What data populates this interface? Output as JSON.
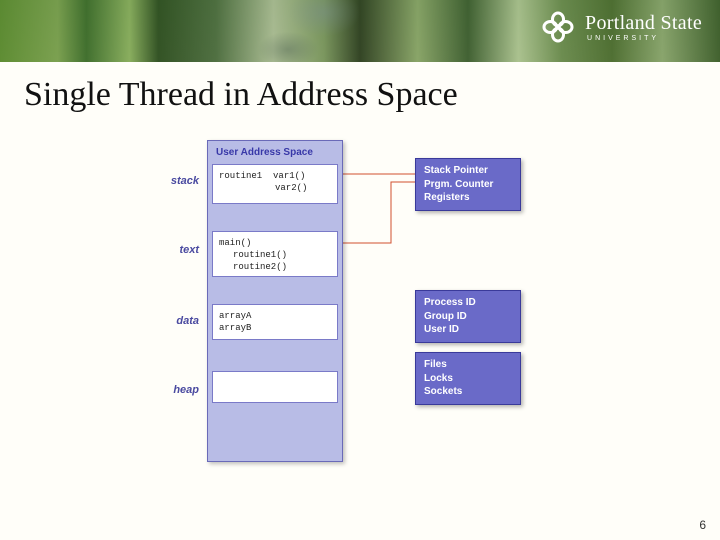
{
  "header": {
    "institution_main": "Portland State",
    "institution_sub": "UNIVERSITY"
  },
  "slide": {
    "title": "Single Thread in Address Space",
    "page_number": "6"
  },
  "diagram": {
    "addr_title": "User Address Space",
    "labels": {
      "stack": "stack",
      "text": "text",
      "data": "data",
      "heap": "heap"
    },
    "segments": {
      "stack": {
        "routine": "routine1",
        "var1": "var1()",
        "var2": "var2()"
      },
      "text": {
        "l1": "main()",
        "l2": "routine1()",
        "l3": "routine2()"
      },
      "data": {
        "l1": "arrayA",
        "l2": "arrayB"
      }
    },
    "right_boxes": {
      "regs": {
        "l1": "Stack Pointer",
        "l2": "Prgm. Counter",
        "l3": "Registers"
      },
      "ids": {
        "l1": "Process ID",
        "l2": "Group ID",
        "l3": "User ID"
      },
      "io": {
        "l1": "Files",
        "l2": "Locks",
        "l3": "Sockets"
      }
    }
  }
}
